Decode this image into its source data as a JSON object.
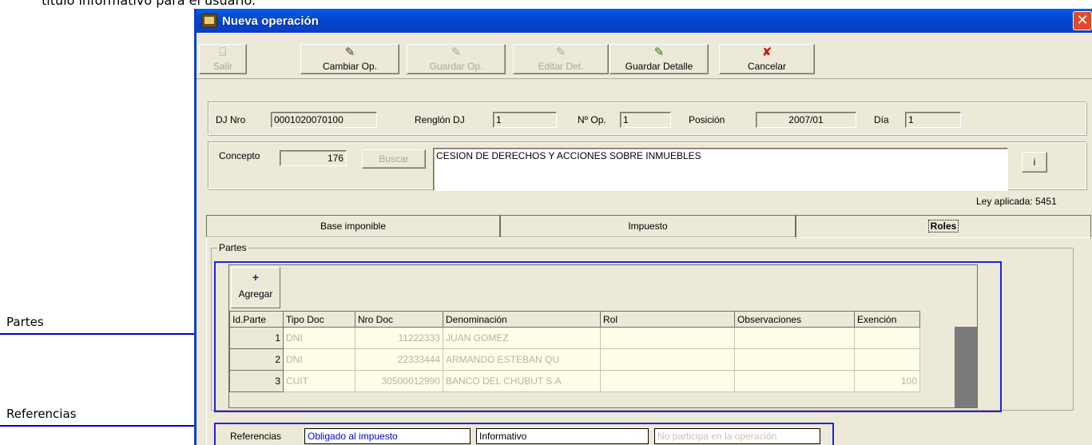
{
  "document": {
    "top_text": "titulo informativo para el usuario."
  },
  "callouts": {
    "partes": "Partes",
    "referencias": "Referencias"
  },
  "window": {
    "title": "Nueva operación",
    "close_glyph": "✕"
  },
  "toolbar": {
    "buttons": [
      {
        "label": "Salir",
        "icon": "exit-door-icon",
        "glyph": "⍈",
        "enabled": false
      },
      {
        "label": "Cambiar Op.",
        "icon": "brush-icon",
        "glyph": "✎",
        "enabled": true
      },
      {
        "label": "Guardar Op.",
        "icon": "brush-icon",
        "glyph": "✎",
        "enabled": false
      },
      {
        "label": "Editar Det.",
        "icon": "brush-icon",
        "glyph": "✎",
        "enabled": false
      },
      {
        "label": "Guardar Detalle",
        "icon": "green-brush-icon",
        "glyph": "✎",
        "enabled": true
      },
      {
        "label": "Cancelar",
        "icon": "red-x-icon",
        "glyph": "✘",
        "enabled": true
      }
    ]
  },
  "header": {
    "dj_nro_label": "DJ Nro",
    "dj_nro_value": "0001020070100",
    "renglon_label": "Renglón DJ",
    "renglon_value": "1",
    "nro_op_label": "Nº Op.",
    "nro_op_value": "1",
    "posicion_label": "Posición",
    "posicion_value": "2007/01",
    "dia_label": "Día",
    "dia_value": "1"
  },
  "concepto": {
    "label": "Concepto",
    "code": "176",
    "buscar_label": "Buscar",
    "description": "CESION DE DERECHOS Y ACCIONES SOBRE INMUEBLES",
    "info_label": "i",
    "ley": "Ley aplicada: 5451"
  },
  "tabs": [
    {
      "label": "Base imponible",
      "active": false
    },
    {
      "label": "Impuesto",
      "active": false
    },
    {
      "label": "Roles",
      "active": true
    }
  ],
  "partes": {
    "legend": "Partes",
    "agregar_label": "Agregar",
    "agregar_glyph": "+",
    "columns": [
      "Id.Parte",
      "Tipo Doc",
      "Nro Doc",
      "Denominación",
      "Rol",
      "Observaciones",
      "Exención"
    ],
    "rows": [
      {
        "id": "1",
        "tipo": "DNI",
        "nro": "11222333",
        "denominacion": "JUAN GOMEZ",
        "rol": "",
        "obs": "",
        "exencion": ""
      },
      {
        "id": "2",
        "tipo": "DNI",
        "nro": "22333444",
        "denominacion": "ARMANDO ESTEBAN QU",
        "rol": "",
        "obs": "",
        "exencion": ""
      },
      {
        "id": "3",
        "tipo": "CUIT",
        "nro": "30500012990",
        "denominacion": "BANCO DEL CHUBUT S.A",
        "rol": "",
        "obs": "",
        "exencion": "100"
      }
    ]
  },
  "referencias": {
    "label": "Referencias",
    "items": [
      {
        "text": "Obligado al impuesto",
        "color": "#0000dd"
      },
      {
        "text": "Informativo",
        "color": "#000000"
      },
      {
        "text": "No participa en la operación",
        "color": "#c8c4b0"
      }
    ]
  },
  "colors": {
    "titlebar": "#0348d2",
    "window_bg": "#ece9d8",
    "annotation_blue": "#0000cc",
    "grid_row_bg": "#fffde8"
  }
}
